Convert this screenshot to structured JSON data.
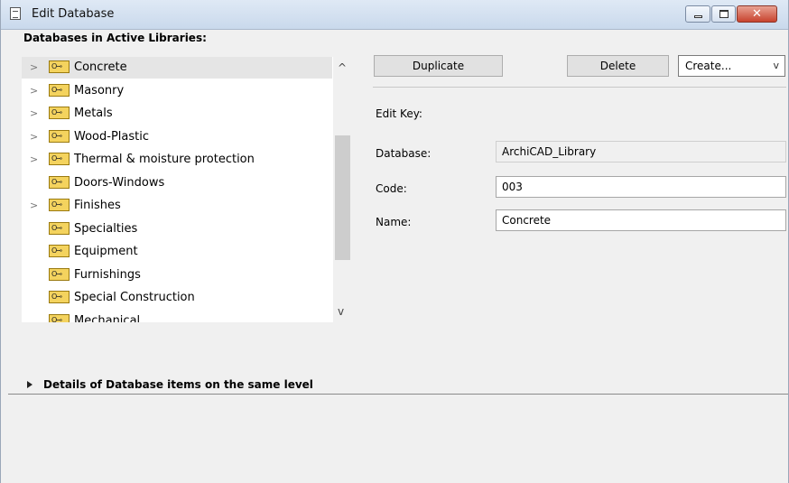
{
  "window": {
    "title": "Edit Database",
    "close_glyph": "✕"
  },
  "tree": {
    "heading": "Databases in Active Libraries:",
    "items": [
      {
        "label": "Concrete",
        "expandable": true,
        "selected": true
      },
      {
        "label": "Masonry",
        "expandable": true
      },
      {
        "label": "Metals",
        "expandable": true
      },
      {
        "label": "Wood-Plastic",
        "expandable": true
      },
      {
        "label": "Thermal & moisture protection",
        "expandable": true
      },
      {
        "label": "Doors-Windows",
        "expandable": false
      },
      {
        "label": "Finishes",
        "expandable": true
      },
      {
        "label": "Specialties",
        "expandable": false
      },
      {
        "label": "Equipment",
        "expandable": false
      },
      {
        "label": "Furnishings",
        "expandable": false
      },
      {
        "label": "Special Construction",
        "expandable": false
      },
      {
        "label": "Mechanical",
        "expandable": false
      }
    ]
  },
  "toolbar": {
    "duplicate_label": "Duplicate",
    "delete_label": "Delete",
    "create_label": "Create..."
  },
  "form": {
    "edit_key_label": "Edit Key:",
    "database_label": "Database:",
    "database_value": "ArchiCAD_Library",
    "code_label": "Code:",
    "code_value": "003",
    "name_label": "Name:",
    "name_value": "Concrete"
  },
  "details": {
    "label": "Details of Database items on the same level"
  }
}
